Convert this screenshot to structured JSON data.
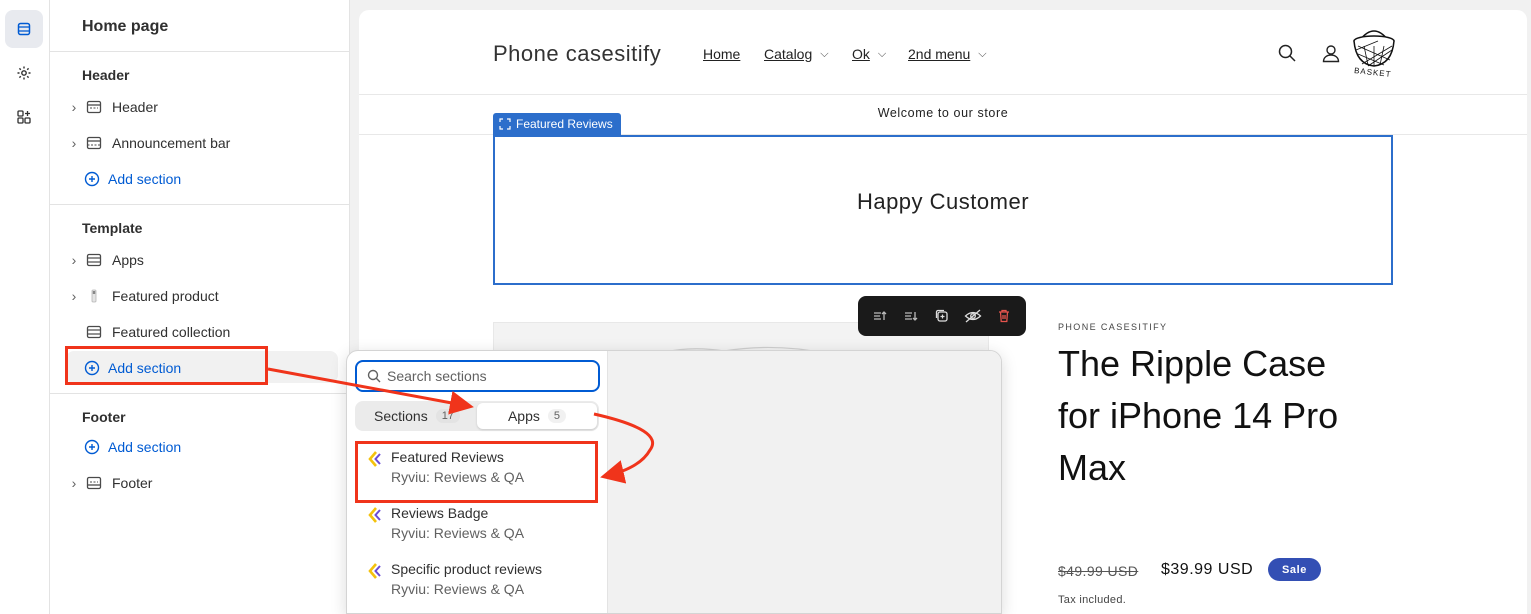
{
  "rail": {
    "items": [
      {
        "icon": "sections-icon"
      },
      {
        "icon": "gear-icon"
      },
      {
        "icon": "apps-icon"
      }
    ]
  },
  "sidebar": {
    "title": "Home page",
    "groups": {
      "header": {
        "title": "Header",
        "items": [
          {
            "label": "Header",
            "icon": "header-layout-icon"
          },
          {
            "label": "Announcement bar",
            "icon": "announcement-layout-icon"
          }
        ],
        "add_label": "Add section"
      },
      "template": {
        "title": "Template",
        "items": [
          {
            "label": "Apps",
            "icon": "apps-layout-icon"
          },
          {
            "label": "Featured product",
            "icon": "product-icon"
          },
          {
            "label": "Featured collection",
            "icon": "collection-layout-icon"
          }
        ],
        "add_label": "Add section"
      },
      "footer": {
        "title": "Footer",
        "add_label": "Add section",
        "items": [
          {
            "label": "Footer",
            "icon": "footer-layout-icon"
          }
        ]
      }
    }
  },
  "preview": {
    "store_name": "Phone casesitify",
    "nav": [
      {
        "label": "Home",
        "has_dropdown": false
      },
      {
        "label": "Catalog",
        "has_dropdown": true
      },
      {
        "label": "Ok",
        "has_dropdown": true
      },
      {
        "label": "2nd menu",
        "has_dropdown": true
      }
    ],
    "basket_label": "BASKET",
    "announcement": "Welcome to our store",
    "section_tag": "Featured Reviews",
    "section_heading": "Happy Customer",
    "toolbar": [
      "move-up-icon",
      "move-down-icon",
      "duplicate-icon",
      "hide-icon",
      "delete-icon"
    ],
    "product": {
      "vendor": "PHONE CASESITIFY",
      "title": "The Ripple Case for iPhone 14 Pro Max",
      "price_old": "$49.99 USD",
      "price_new": "$39.99 USD",
      "badge": "Sale",
      "tax": "Tax included."
    }
  },
  "popover": {
    "search_placeholder": "Search sections",
    "tabs": [
      {
        "label": "Sections",
        "count": "17",
        "active": false
      },
      {
        "label": "Apps",
        "count": "5",
        "active": true
      }
    ],
    "apps": [
      {
        "name": "Featured Reviews",
        "provider": "Ryviu: Reviews & QA"
      },
      {
        "name": "Reviews Badge",
        "provider": "Ryviu: Reviews & QA"
      },
      {
        "name": "Specific product reviews",
        "provider": "Ryviu: Reviews & QA"
      }
    ]
  },
  "colors": {
    "accent": "#005bd3",
    "section_outline": "#2c6ecb",
    "annotation": "#f0341b",
    "sale_badge": "#334fb4"
  }
}
